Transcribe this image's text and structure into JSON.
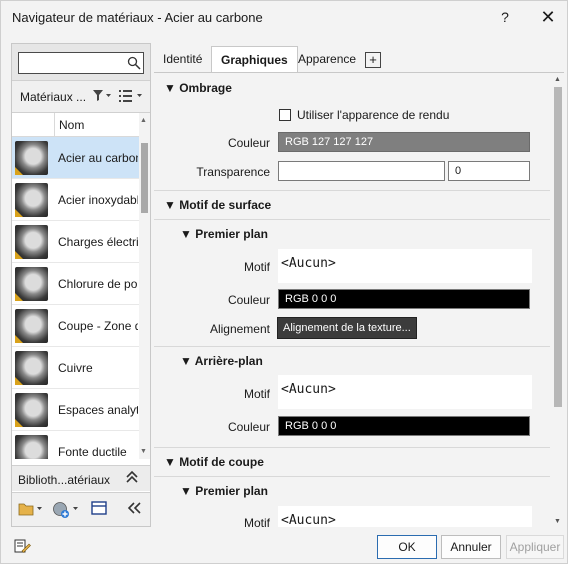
{
  "window": {
    "title": "Navigateur de matériaux - Acier au carbone",
    "help": "?",
    "close": "✕"
  },
  "left": {
    "search_value": "",
    "library_label": "Matériaux ...",
    "column_name": "Nom",
    "materials": [
      {
        "name": "Acier au carbone",
        "selected": true
      },
      {
        "name": "Acier inoxydable",
        "selected": false
      },
      {
        "name": "Charges électriques",
        "selected": false
      },
      {
        "name": "Chlorure de polyvinyle",
        "selected": false
      },
      {
        "name": "Coupe - Zone de coupe",
        "selected": false
      },
      {
        "name": "Cuivre",
        "selected": false
      },
      {
        "name": "Espaces analytiques",
        "selected": false
      },
      {
        "name": "Fonte ductile",
        "selected": false
      }
    ],
    "library_footer": "Biblioth...atériaux"
  },
  "tabs": [
    {
      "label": "Identité",
      "active": false
    },
    {
      "label": "Graphiques",
      "active": true
    },
    {
      "label": "Apparence",
      "active": false
    }
  ],
  "tab_add": "+",
  "graphics": {
    "shading": {
      "title": "Ombrage",
      "use_render_label": "Utiliser l'apparence de rendu",
      "color_label": "Couleur",
      "color_value": "RGB 127 127 127",
      "transparency_label": "Transparence",
      "transparency_value": "0"
    },
    "surface_pattern": {
      "title": "Motif de surface",
      "foreground": {
        "title": "Premier plan",
        "pattern_label": "Motif",
        "pattern_value": "<Aucun>",
        "color_label": "Couleur",
        "color_value": "RGB 0 0 0",
        "alignment_label": "Alignement",
        "alignment_button": "Alignement de la texture..."
      },
      "background": {
        "title": "Arrière-plan",
        "pattern_label": "Motif",
        "pattern_value": "<Aucun>",
        "color_label": "Couleur",
        "color_value": "RGB 0 0 0"
      }
    },
    "cut_pattern": {
      "title": "Motif de coupe",
      "foreground": {
        "title": "Premier plan",
        "pattern_label": "Motif",
        "pattern_value": "<Aucun>"
      }
    }
  },
  "buttons": {
    "ok": "OK",
    "cancel": "Annuler",
    "apply": "Appliquer"
  },
  "colors": {
    "selected_row": "#cde3f7",
    "shading_swatch": "#7f7f7f",
    "black_swatch": "#000000",
    "primary_border": "#2b6cb0"
  }
}
